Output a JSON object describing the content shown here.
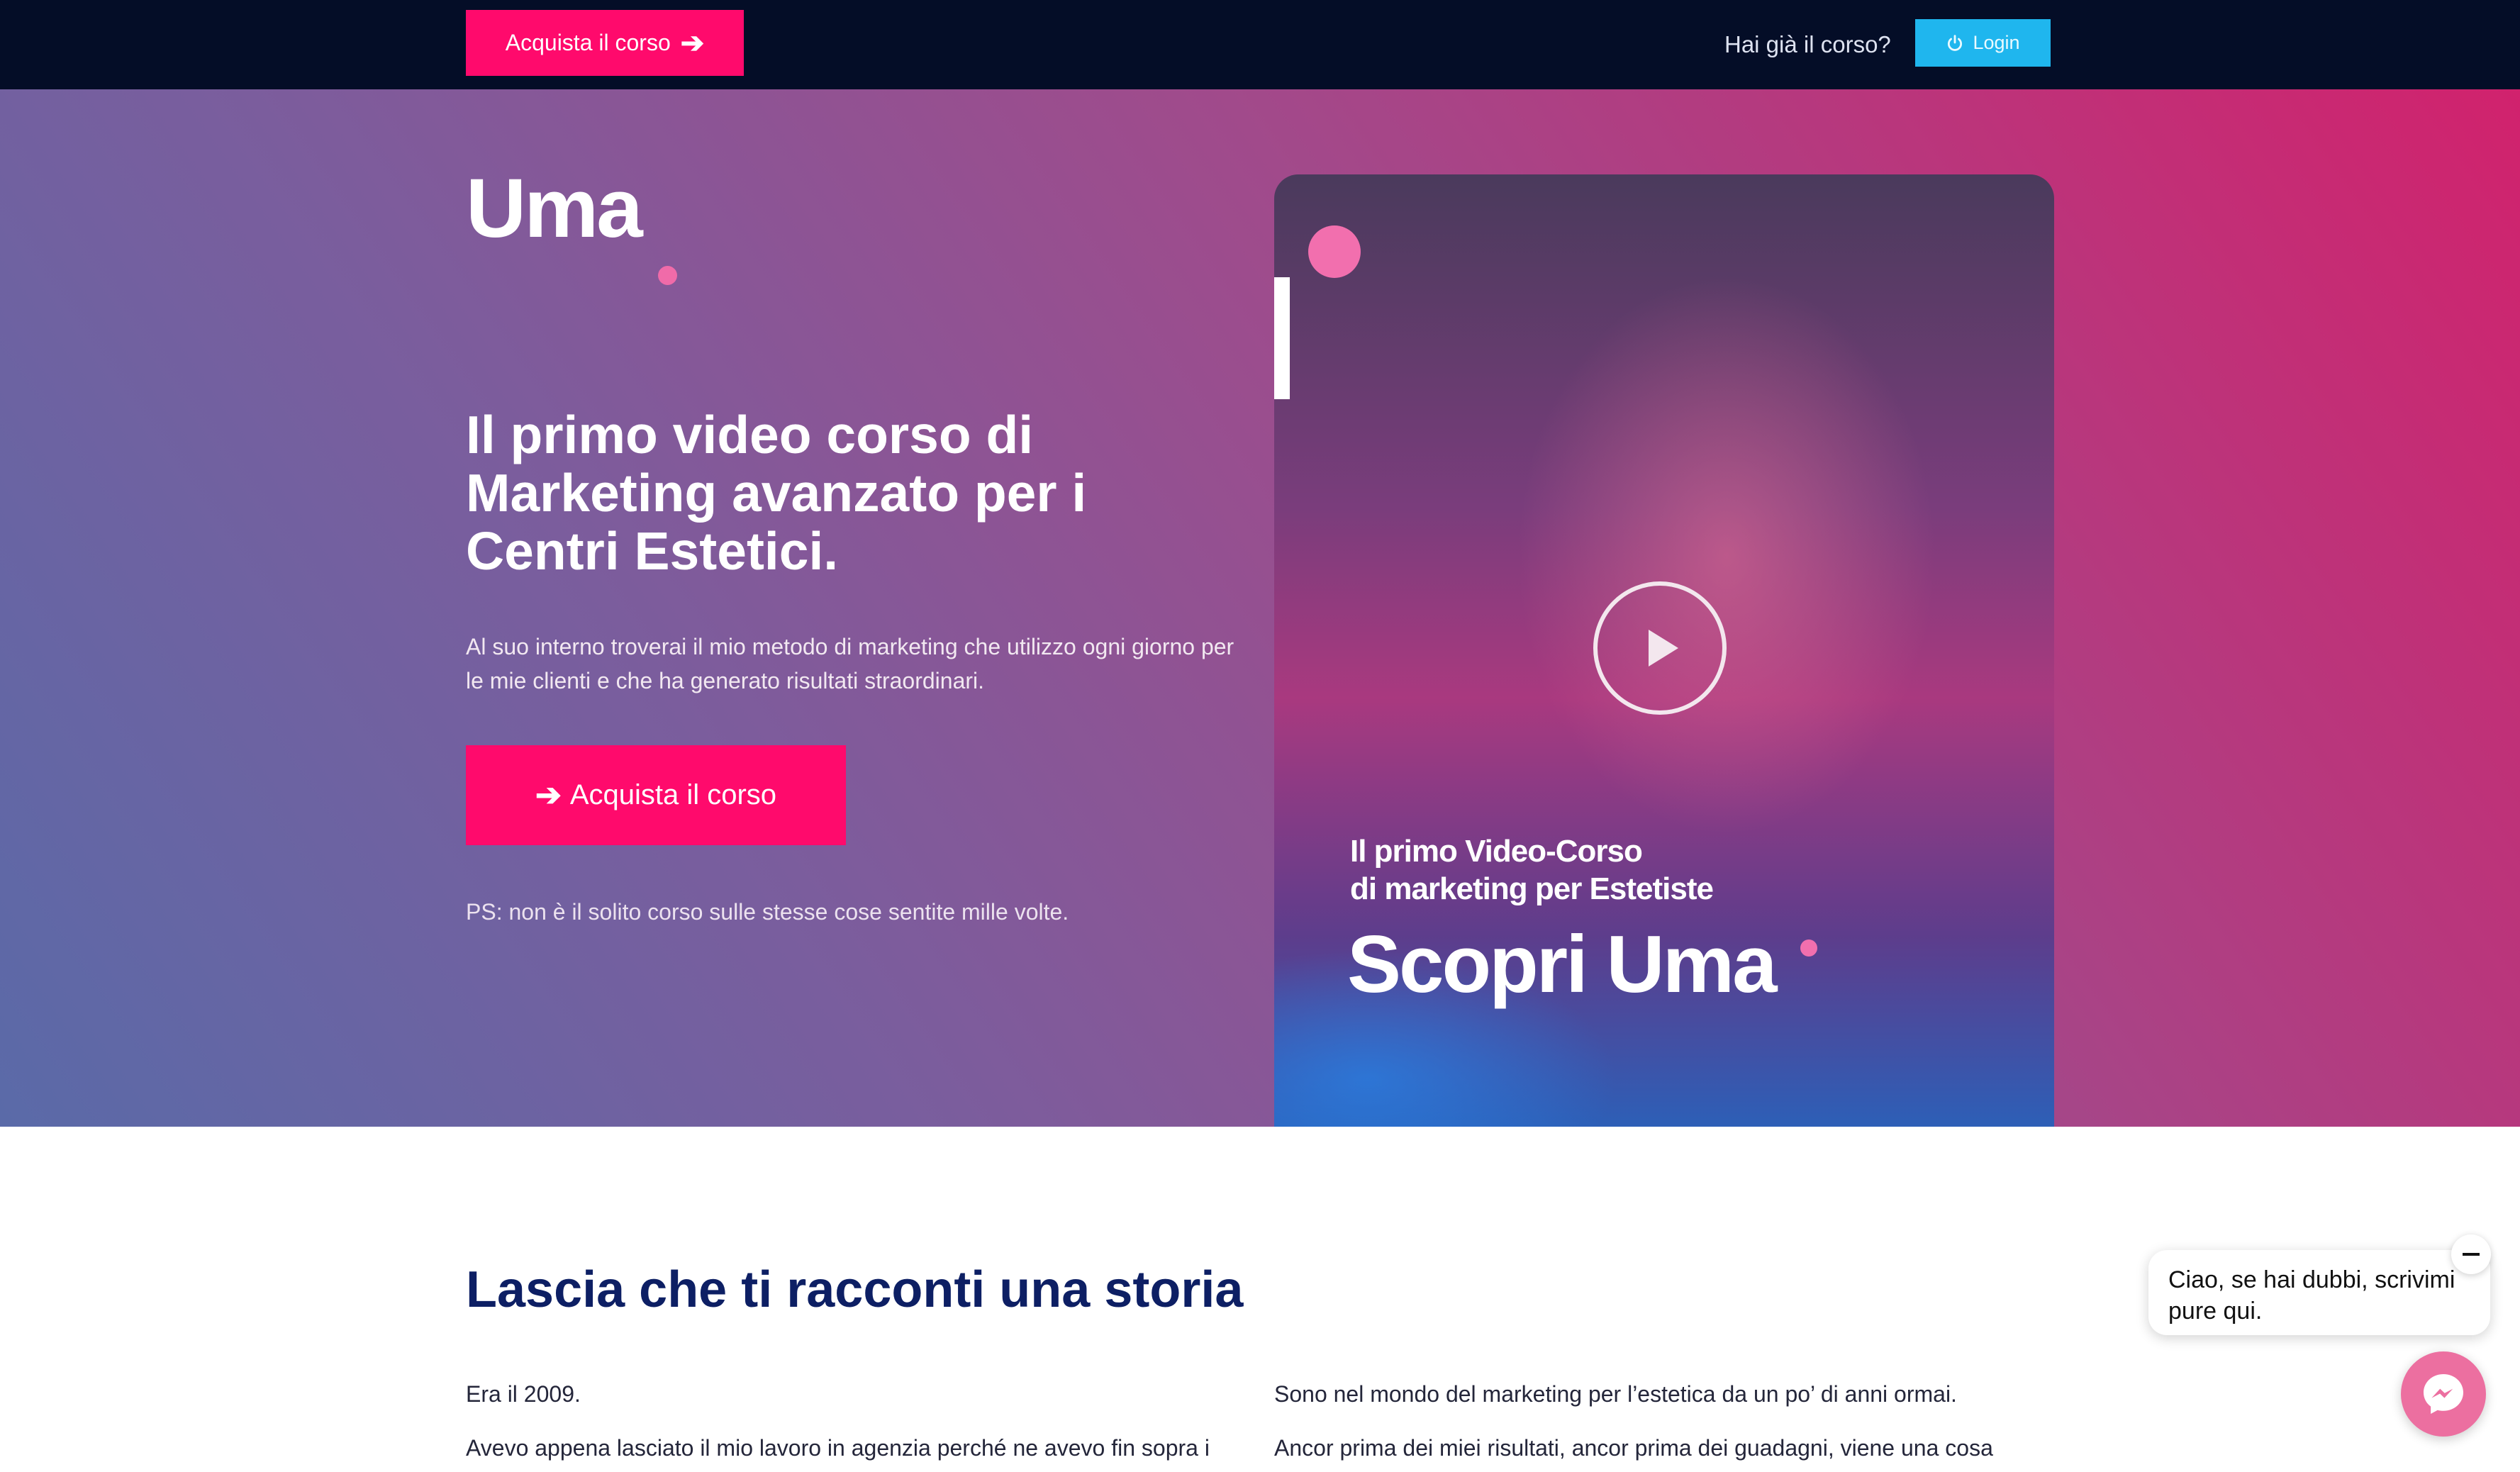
{
  "topbar": {
    "buy_label": "Acquista il corso",
    "already_label": "Hai già il corso?",
    "login_label": "Login"
  },
  "hero": {
    "logo_text": "Uma",
    "headline": "Il primo video corso di Marketing avanzato per i Centri Estetici.",
    "intro": "Al suo interno troverai il mio metodo di marketing che utilizzo ogni giorno per le mie clienti e che ha generato risultati straordinari.",
    "buy_label": "Acquista il corso",
    "ps": "PS: non è il solito corso sulle stesse cose sentite mille volte."
  },
  "video": {
    "subtitle_line1": "Il primo Video-Corso",
    "subtitle_line2": "di marketing per Estetiste",
    "title": "Scopri Uma"
  },
  "story": {
    "title": "Lascia che ti racconti una storia",
    "left": [
      "Era il 2009.",
      "Avevo appena lasciato il mio lavoro in agenzia perché ne avevo fin sopra i"
    ],
    "right": [
      "Sono nel mondo del marketing per l’estetica da un po’ di anni ormai.",
      "Ancor prima dei miei risultati, ancor prima dei guadagni, viene una cosa"
    ]
  },
  "chat": {
    "message": "Ciao, se hai dubbi, scrivimi pure qui."
  },
  "colors": {
    "topbar": "#040d27",
    "accent_pink": "#ff0a6c",
    "login_blue": "#1fb6ee",
    "story_title": "#0d1f64"
  },
  "icons": [
    "arrow-right-icon",
    "power-icon",
    "play-icon",
    "minus-icon",
    "messenger-icon"
  ]
}
